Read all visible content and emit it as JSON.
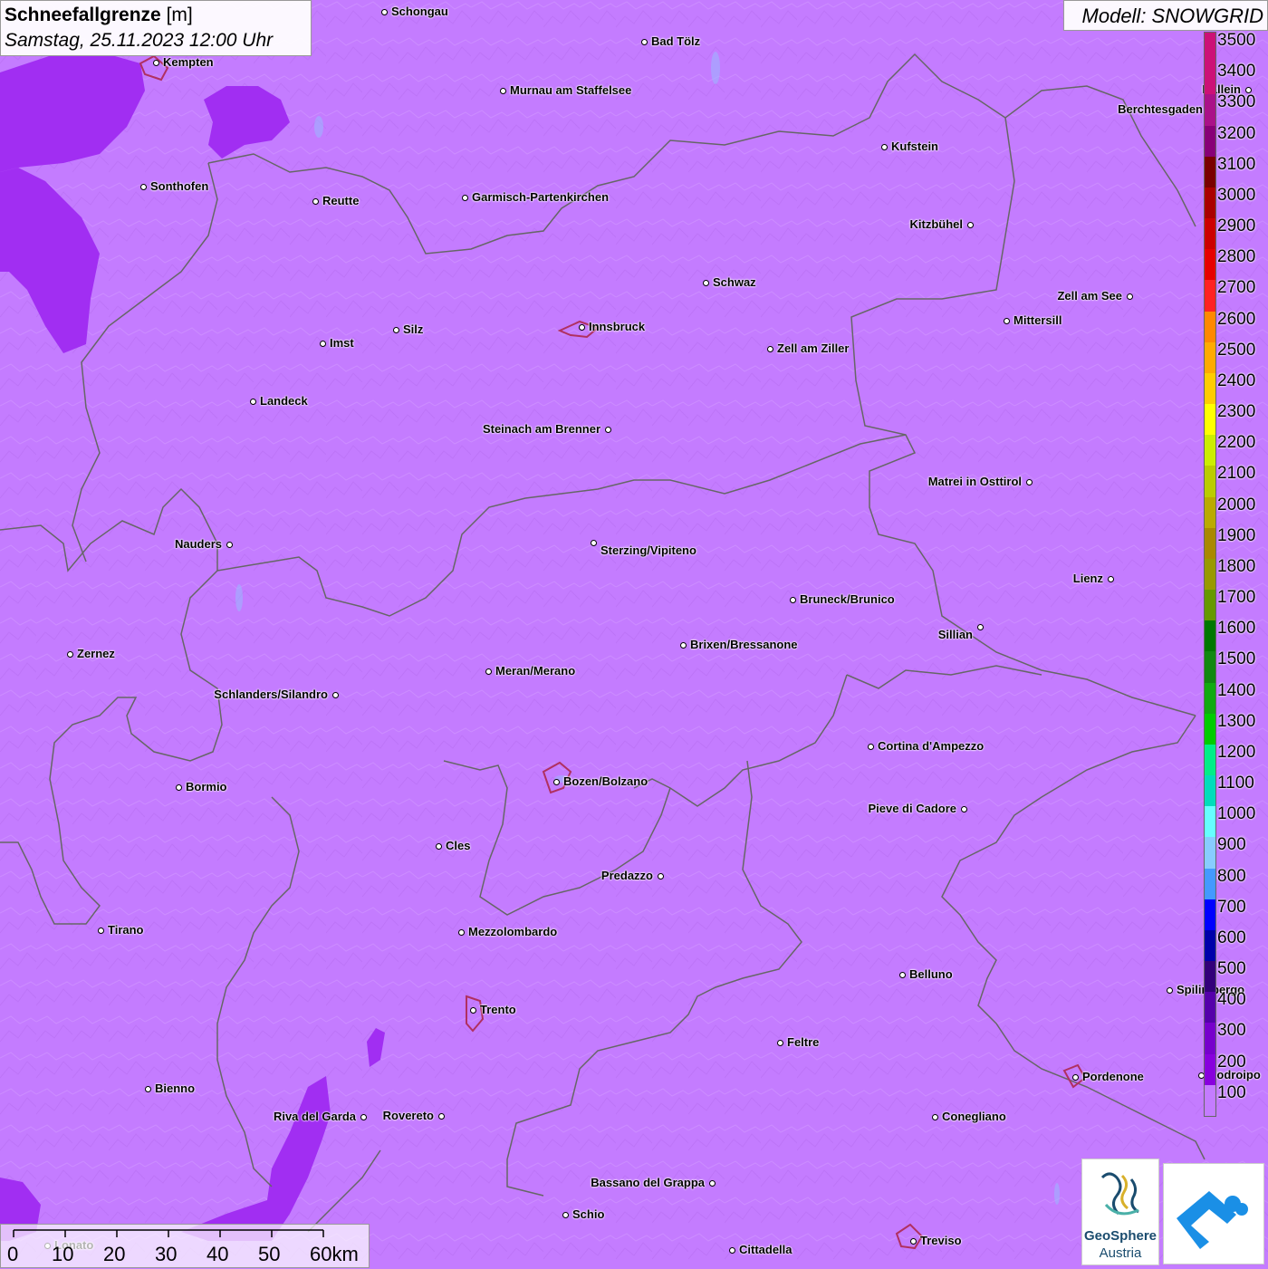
{
  "title": {
    "label_bold": "Schneefallgrenze",
    "unit": "[m]",
    "datetime": "Samstag, 25.11.2023 12:00 Uhr"
  },
  "model": {
    "label": "Modell: SNOWGRID"
  },
  "map": {
    "field_value_m": 100,
    "colors": {
      "base": "#c47cff",
      "low_zone": "#a020f0",
      "border": "#666666",
      "water": "#9ab8ff",
      "city_outline": "#b03060"
    }
  },
  "cities": [
    {
      "name": "Schongau"
    },
    {
      "name": "Bad Tölz"
    },
    {
      "name": "Kempten"
    },
    {
      "name": "Murnau am Staffelsee"
    },
    {
      "name": "Hallein"
    },
    {
      "name": "Berchtesgaden"
    },
    {
      "name": "Kufstein"
    },
    {
      "name": "Sonthofen"
    },
    {
      "name": "Reutte"
    },
    {
      "name": "Garmisch-Partenkirchen"
    },
    {
      "name": "Kitzbühel"
    },
    {
      "name": "Schwaz"
    },
    {
      "name": "Zell am See"
    },
    {
      "name": "Mittersill"
    },
    {
      "name": "Innsbruck"
    },
    {
      "name": "Imst"
    },
    {
      "name": "Silz"
    },
    {
      "name": "Zell am Ziller"
    },
    {
      "name": "Landeck"
    },
    {
      "name": "Steinach am Brenner"
    },
    {
      "name": "Matrei in Osttirol"
    },
    {
      "name": "Nauders"
    },
    {
      "name": "Sterzing/Vipiteno"
    },
    {
      "name": "Lienz"
    },
    {
      "name": "Bruneck/Brunico"
    },
    {
      "name": "Sillian"
    },
    {
      "name": "Brixen/Bressanone"
    },
    {
      "name": "Zernez"
    },
    {
      "name": "Meran/Merano"
    },
    {
      "name": "Schlanders/Silandro"
    },
    {
      "name": "Cortina d'Ampezzo"
    },
    {
      "name": "Bozen/Bolzano"
    },
    {
      "name": "Bormio"
    },
    {
      "name": "Pieve di Cadore"
    },
    {
      "name": "Cles"
    },
    {
      "name": "Predazzo"
    },
    {
      "name": "Tirano"
    },
    {
      "name": "Mezzolombardo"
    },
    {
      "name": "Belluno"
    },
    {
      "name": "Spilimbergo"
    },
    {
      "name": "Trento"
    },
    {
      "name": "Feltre"
    },
    {
      "name": "Pordenone"
    },
    {
      "name": "Codroipo"
    },
    {
      "name": "Bienno"
    },
    {
      "name": "Riva del Garda"
    },
    {
      "name": "Rovereto"
    },
    {
      "name": "Conegliano"
    },
    {
      "name": "Bassano del Grappa"
    },
    {
      "name": "Schio"
    },
    {
      "name": "Treviso"
    },
    {
      "name": "Cittadella"
    },
    {
      "name": "Lonato"
    }
  ],
  "legend": {
    "values": [
      "3500",
      "3400",
      "3300",
      "3200",
      "3100",
      "3000",
      "2900",
      "2800",
      "2700",
      "2600",
      "2500",
      "2400",
      "2300",
      "2200",
      "2100",
      "2000",
      "1900",
      "1800",
      "1700",
      "1600",
      "1500",
      "1400",
      "1300",
      "1200",
      "1100",
      "1000",
      "900",
      "800",
      "700",
      "600",
      "500",
      "400",
      "300",
      "200",
      "100"
    ],
    "colors": [
      "#cc1177",
      "#cc1177",
      "#aa1188",
      "#880077",
      "#7a0000",
      "#aa0000",
      "#cc0000",
      "#e60000",
      "#ff2222",
      "#ff8800",
      "#ffaa00",
      "#ffcc00",
      "#ffff00",
      "#ccee00",
      "#bbcc00",
      "#bbaa00",
      "#aa8800",
      "#999900",
      "#669900",
      "#007700",
      "#118811",
      "#11aa11",
      "#00cc00",
      "#00ee88",
      "#00ddbb",
      "#66ffff",
      "#88ccff",
      "#4499ff",
      "#0000ff",
      "#0000aa",
      "#33007a",
      "#5500aa",
      "#7700cc",
      "#8800dd",
      "#c47cff"
    ]
  },
  "scale": {
    "ticks": [
      "0",
      "10",
      "20",
      "30",
      "40",
      "50",
      "60km"
    ]
  },
  "logo": {
    "line1": "GeoSphere",
    "line2": "Austria",
    "app_color": "#1a8fe6"
  }
}
